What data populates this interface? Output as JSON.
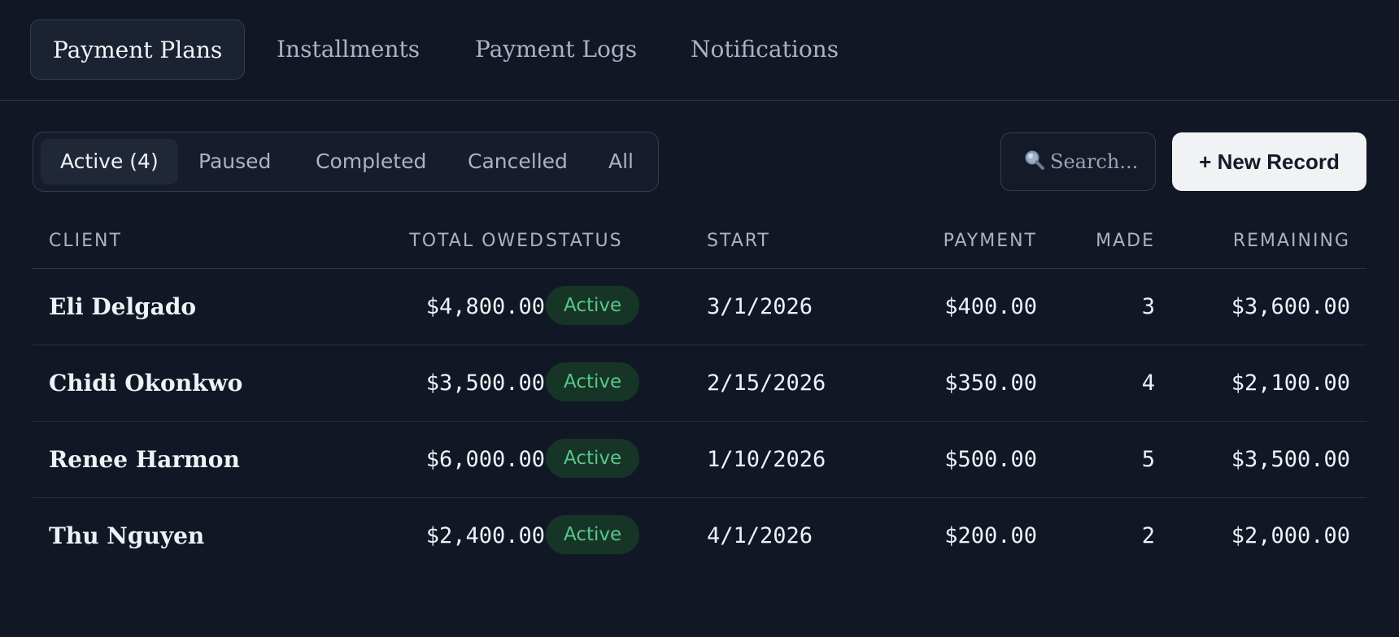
{
  "top_tabs": [
    {
      "label": "Payment Plans"
    },
    {
      "label": "Installments"
    },
    {
      "label": "Payment Logs"
    },
    {
      "label": "Notifications"
    }
  ],
  "filters": [
    {
      "label": "Active (4)"
    },
    {
      "label": "Paused"
    },
    {
      "label": "Completed"
    },
    {
      "label": "Cancelled"
    },
    {
      "label": "All"
    }
  ],
  "search": {
    "placeholder": "Search..."
  },
  "new_record_label": "+ New Record",
  "table": {
    "headers": {
      "client": "CLIENT",
      "total_owed": "TOTAL OWED",
      "status": "STATUS",
      "start": "START",
      "payment": "PAYMENT",
      "made": "MADE",
      "remaining": "REMAINING"
    },
    "rows": [
      {
        "client": "Eli Delgado",
        "total_owed": "$4,800.00",
        "status": "Active",
        "start": "3/1/2026",
        "payment": "$400.00",
        "made": "3",
        "remaining": "$3,600.00"
      },
      {
        "client": "Chidi Okonkwo",
        "total_owed": "$3,500.00",
        "status": "Active",
        "start": "2/15/2026",
        "payment": "$350.00",
        "made": "4",
        "remaining": "$2,100.00"
      },
      {
        "client": "Renee Harmon",
        "total_owed": "$6,000.00",
        "status": "Active",
        "start": "1/10/2026",
        "payment": "$500.00",
        "made": "5",
        "remaining": "$3,500.00"
      },
      {
        "client": "Thu Nguyen",
        "total_owed": "$2,400.00",
        "status": "Active",
        "start": "4/1/2026",
        "payment": "$200.00",
        "made": "2",
        "remaining": "$2,000.00"
      }
    ]
  },
  "colors": {
    "background": "#121725",
    "active_badge_bg": "#173526",
    "active_badge_text": "#56c78a",
    "primary_button_bg": "#f1f2f4"
  },
  "icons": {
    "search": "magnifying-glass-icon"
  }
}
